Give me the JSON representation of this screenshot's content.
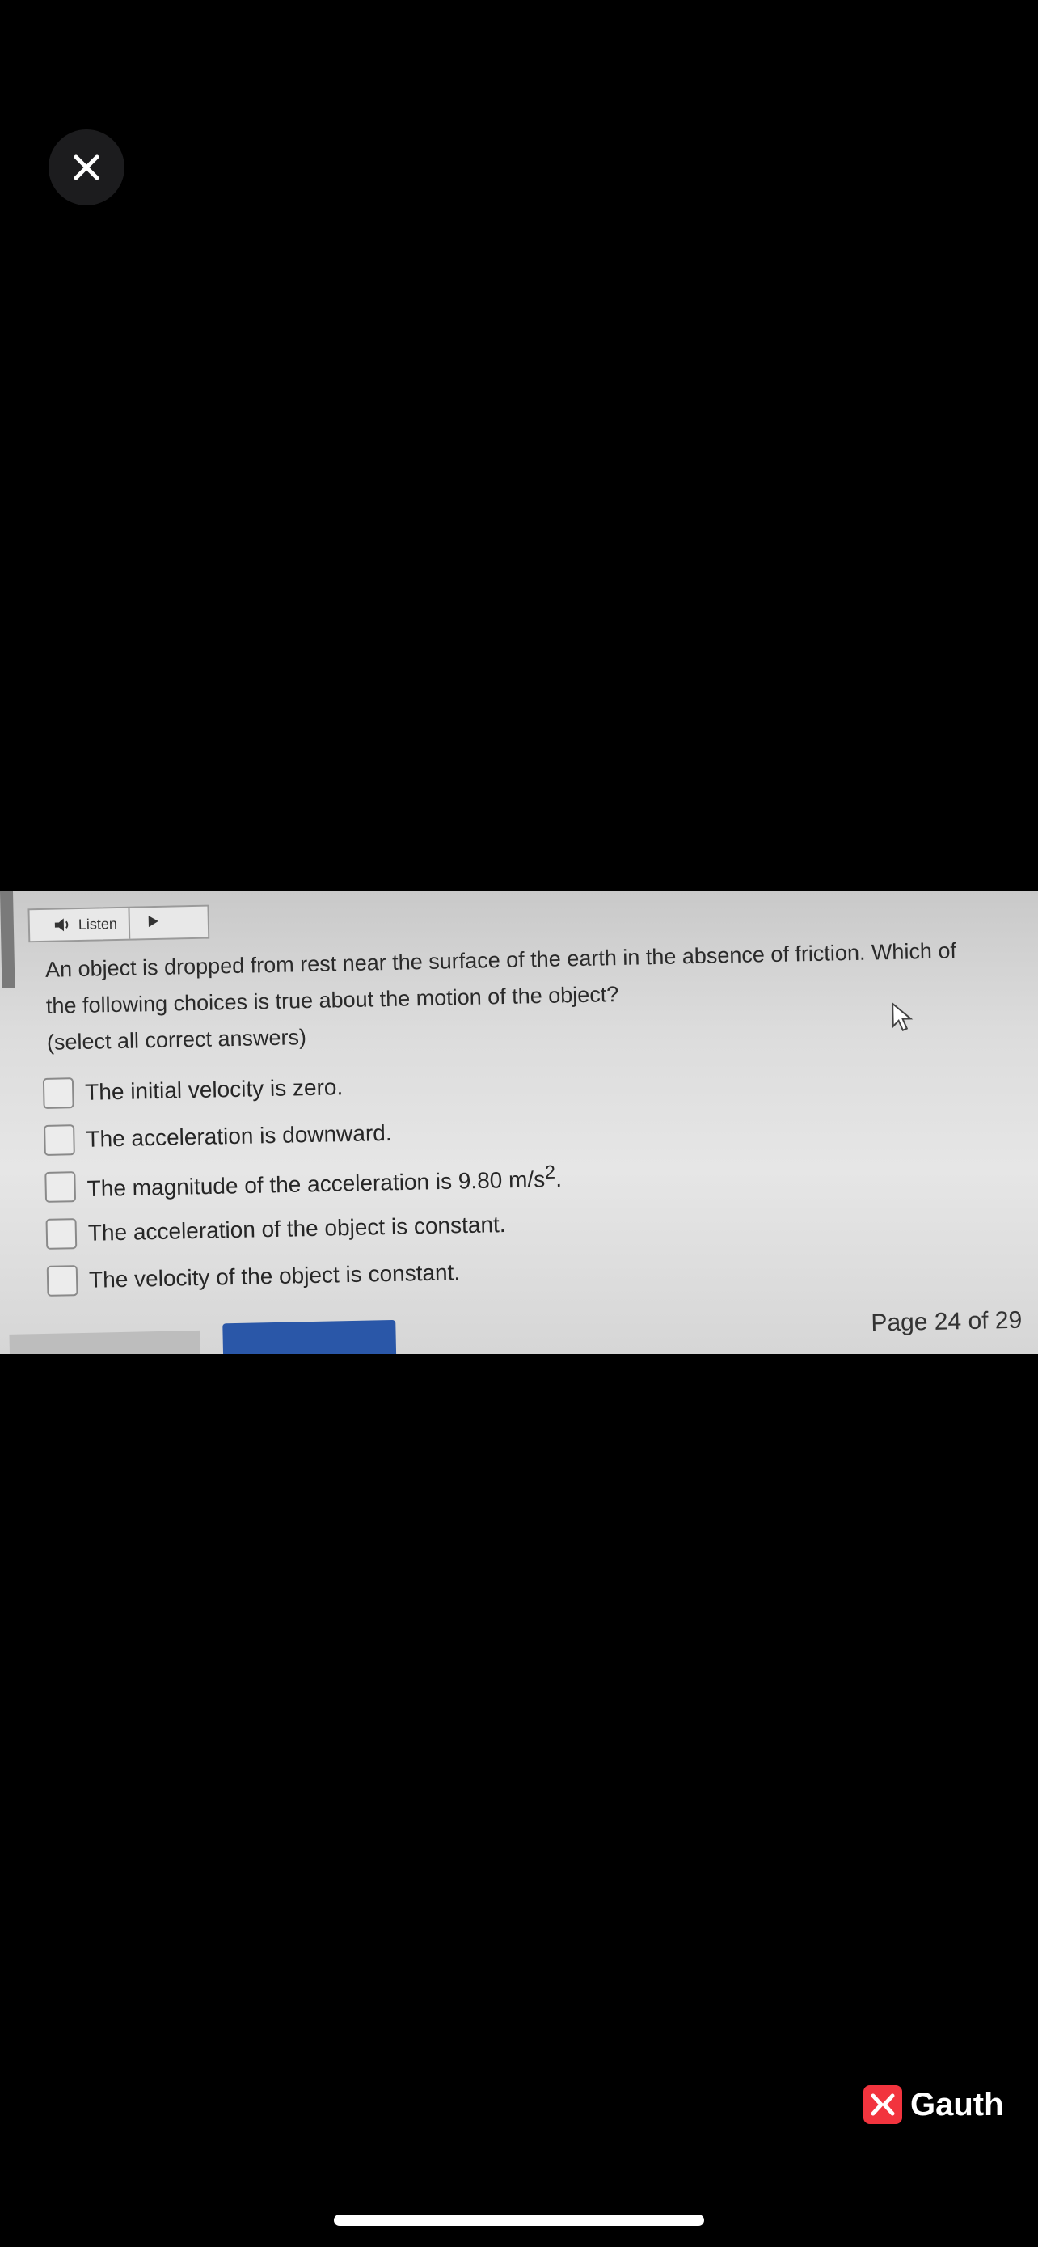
{
  "viewer": {
    "close_icon": "close-icon"
  },
  "question": {
    "listen_label": "Listen",
    "listen_icon": "speaker-icon",
    "play_icon": "play-icon",
    "text": "An object is dropped from rest near the surface of the earth in the absence of friction. Which of the following choices is true about the motion of the object?",
    "instruction": "(select all correct answers)",
    "options": [
      {
        "label": "The initial velocity is zero.",
        "checked": false
      },
      {
        "label": "The acceleration is downward.",
        "checked": false
      },
      {
        "label_prefix": "The magnitude of the acceleration is 9.80 m/s",
        "label_sup": "2",
        "label_suffix": ".",
        "checked": false
      },
      {
        "label": "The acceleration of the object is constant.",
        "checked": false
      },
      {
        "label": "The velocity of the object is constant.",
        "checked": false
      }
    ]
  },
  "pagination": {
    "page_text": "Page 24 of 29"
  },
  "branding": {
    "name": "Gauth",
    "logo_icon": "gauth-logo-icon",
    "accent_color": "#f2343e"
  }
}
